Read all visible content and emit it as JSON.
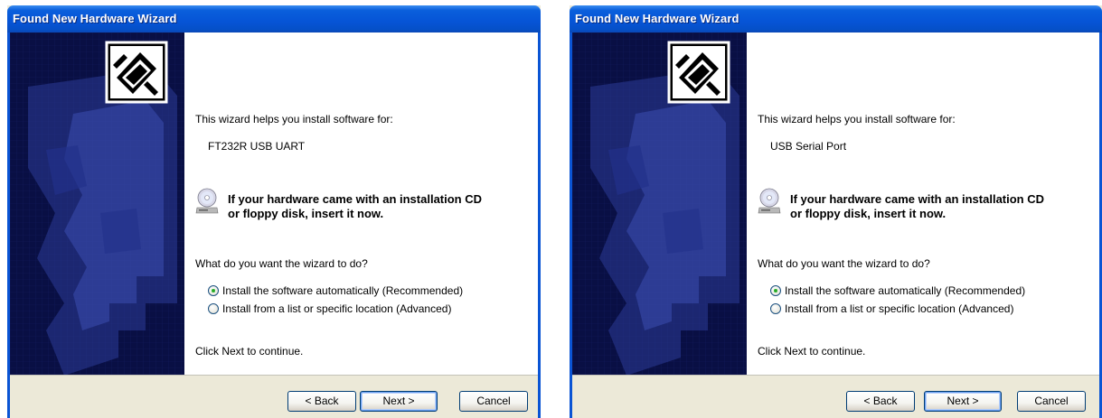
{
  "wizards": [
    {
      "title": "Found New Hardware Wizard",
      "intro": "This wizard helps you install software for:",
      "device_name": "FT232R USB UART",
      "cd_message_line1": "If your hardware came with an installation CD",
      "cd_message_line2": "or floppy disk, insert it now.",
      "question": "What do you want the wizard to do?",
      "options": [
        {
          "label": "Install the software automatically (Recommended)",
          "selected": true
        },
        {
          "label": "Install from a list or specific location (Advanced)",
          "selected": false
        }
      ],
      "footer_hint": "Click Next to continue.",
      "buttons": {
        "back": "< Back",
        "next": "Next >",
        "cancel": "Cancel"
      }
    },
    {
      "title": "Found New Hardware Wizard",
      "intro": "This wizard helps you install software for:",
      "device_name": "USB Serial Port",
      "cd_message_line1": "If your hardware came with an installation CD",
      "cd_message_line2": "or floppy disk, insert it now.",
      "question": "What do you want the wizard to do?",
      "options": [
        {
          "label": "Install the software automatically (Recommended)",
          "selected": true
        },
        {
          "label": "Install from a list or specific location (Advanced)",
          "selected": false
        }
      ],
      "footer_hint": "Click Next to continue.",
      "buttons": {
        "back": "< Back",
        "next": "Next >",
        "cancel": "Cancel"
      }
    }
  ],
  "icons": {
    "wizard_graphic": "hardware-card-icon",
    "cd": "cd-drive-icon"
  },
  "colors": {
    "title_bar": "#0654d6",
    "side_panel": "#090f44",
    "dialog_face": "#ece9d8",
    "radio_dot": "#21a121"
  }
}
